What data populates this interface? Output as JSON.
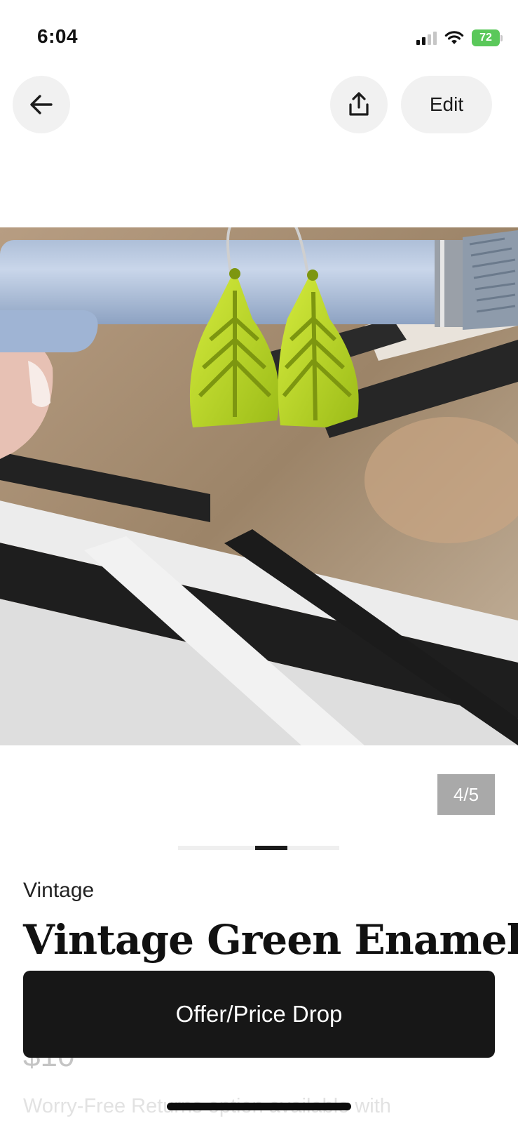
{
  "status_bar": {
    "time": "6:04",
    "battery_level": "72",
    "icons": [
      "cellular-signal-icon",
      "wifi-icon",
      "battery-charging-icon"
    ]
  },
  "nav": {
    "back_icon": "arrow-left-icon",
    "share_icon": "share-upload-icon",
    "edit_label": "Edit"
  },
  "gallery": {
    "counter": "4/5",
    "current_index": 4,
    "total": 5,
    "image_subject": "green-enamel-leaf-hoop-earrings-photo"
  },
  "listing": {
    "category": "Vintage",
    "title": "Vintage Green Enamel",
    "price": "$10",
    "returns_text": "Worry-Free Returns option available with"
  },
  "cta": {
    "label": "Offer/Price Drop"
  },
  "colors": {
    "cta_background": "#171717",
    "button_background": "#f1f1f1",
    "counter_background": "#a9a9a9",
    "battery_green": "#5ac85a"
  }
}
